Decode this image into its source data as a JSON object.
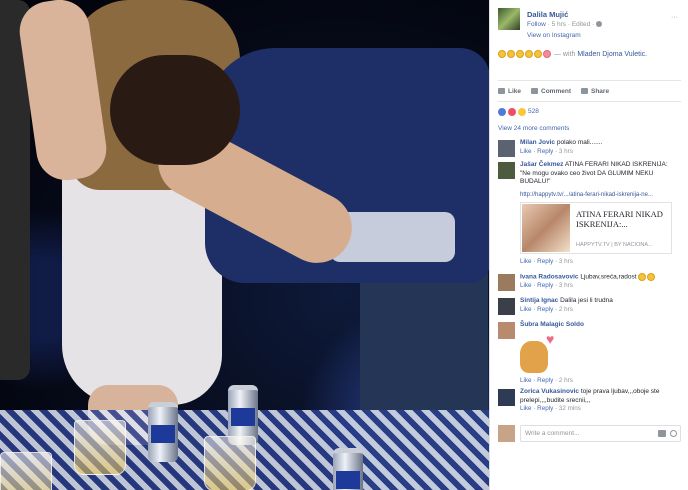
{
  "post": {
    "author": "Dalila Mujić",
    "follow": "Follow",
    "time": "5 hrs",
    "edited": "Edited",
    "view_instagram": "View on Instagram",
    "options": "···",
    "caption_with": "— with",
    "tagged": "Mladen Djoma Vuletic."
  },
  "actions": {
    "like": "Like",
    "comment": "Comment",
    "share": "Share"
  },
  "reactions": {
    "count": "528"
  },
  "view_more": "View 24 more comments",
  "comments": [
    {
      "name": "Milan Jovic",
      "text": "polako mali.......",
      "like": "Like",
      "reply": "Reply",
      "time": "3 hrs"
    },
    {
      "name": "Jašar Čekmez",
      "text": "ATINA FERARI NIKAD ISKRENIJA: \"Ne mogu ovako ceo život DA GLUMIM NEKU BUDALU!\"",
      "link_url": "http://happytv.tv/.../atina-ferari-nikad-iskrenija-ne...",
      "link_title": "ATINA FERARI NIKAD ISKRENIJA:...",
      "link_domain": "HAPPYTV.TV | BY NACIONA...",
      "like": "Like",
      "reply": "Reply",
      "time": "3 hrs"
    },
    {
      "name": "Ivana Radosavovic",
      "text": "Ljubav,sreća,radost",
      "like": "Like",
      "reply": "Reply",
      "time": "3 hrs"
    },
    {
      "name": "Sintija Ignac",
      "text": "Dalila jesi li trudna",
      "like": "Like",
      "reply": "Reply",
      "time": "2 hrs"
    },
    {
      "name": "Šubra Malagic Soldo",
      "text": "",
      "like": "Like",
      "reply": "Reply",
      "time": "2 hrs"
    },
    {
      "name": "Zorica Vukasinovic",
      "text": "toje prava ljubav,,,oboje ste prelepi,,,,budite srecnii,,,",
      "like": "Like",
      "reply": "Reply",
      "time": "32 mins"
    }
  ],
  "write_comment": {
    "placeholder": "Write a comment..."
  }
}
